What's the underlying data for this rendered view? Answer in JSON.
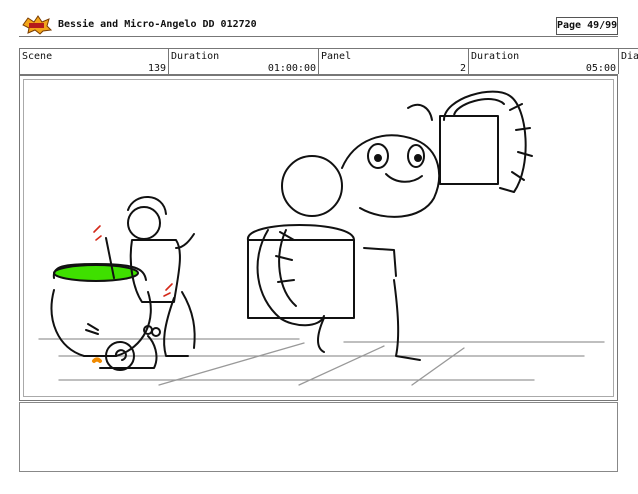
{
  "header": {
    "title": "Bessie and Micro-Angelo DD 012720",
    "page_label": "Page 49/99",
    "logo_icon": "studio-logo-icon"
  },
  "fields": {
    "scene_label": "Scene",
    "scene_value": "139",
    "duration1_label": "Duration",
    "duration1_value": "01:00:00",
    "panel_label": "Panel",
    "panel_value": "2",
    "duration2_label": "Duration",
    "duration2_value": "05:00",
    "dialogue_label": "Dia"
  },
  "drawing": {
    "accent_green": "#3fe000",
    "accent_orange": "#f08a00",
    "accent_red": "#d42a1a"
  }
}
